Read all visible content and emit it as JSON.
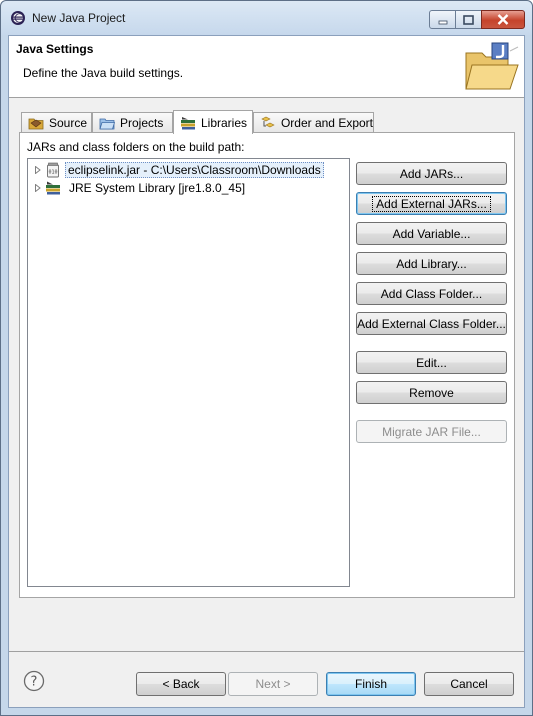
{
  "window": {
    "title": "New Java Project"
  },
  "header": {
    "title": "Java Settings",
    "description": "Define the Java build settings."
  },
  "tabs": [
    {
      "label": "Source",
      "active": false
    },
    {
      "label": "Projects",
      "active": false
    },
    {
      "label": "Libraries",
      "active": true
    },
    {
      "label": "Order and Export",
      "active": false
    }
  ],
  "libraries": {
    "label": "JARs and class folders on the build path:",
    "entries": [
      {
        "label": "eclipselink.jar - C:\\Users\\Classroom\\Downloads",
        "icon": "jar-icon",
        "selected": true
      },
      {
        "label": "JRE System Library [jre1.8.0_45]",
        "icon": "library-icon",
        "selected": false
      }
    ]
  },
  "buttons": {
    "add_jars": "Add JARs...",
    "add_external_jars": "Add External JARs...",
    "add_variable": "Add Variable...",
    "add_library": "Add Library...",
    "add_class_folder": "Add Class Folder...",
    "add_external_class_folder": "Add External Class Folder...",
    "edit": "Edit...",
    "remove": "Remove",
    "migrate_jar": "Migrate JAR File..."
  },
  "footer": {
    "back": "< Back",
    "next": "Next >",
    "finish": "Finish",
    "cancel": "Cancel"
  }
}
